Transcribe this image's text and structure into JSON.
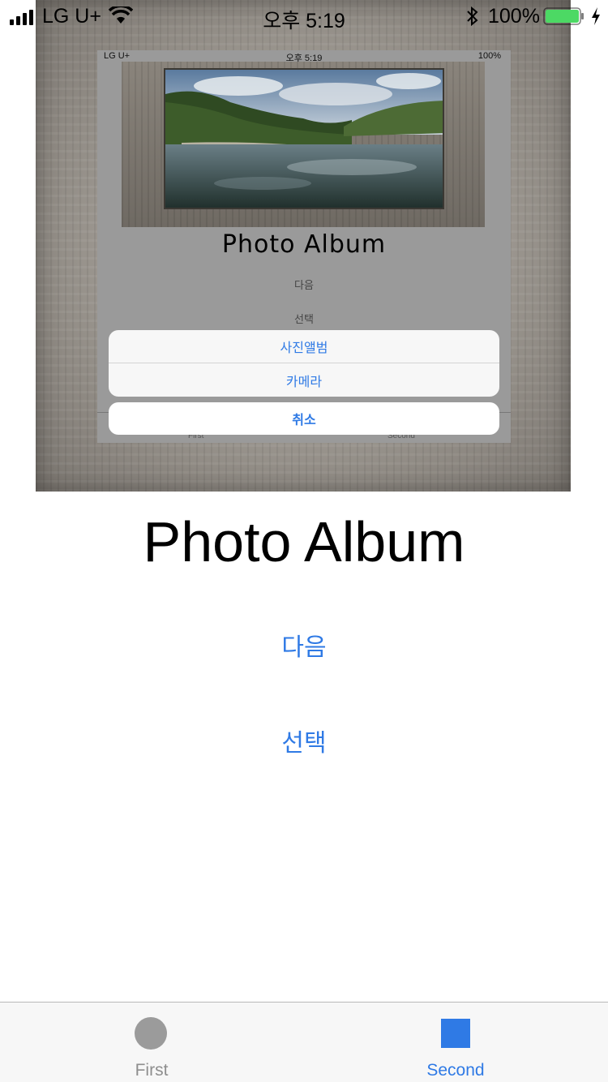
{
  "status_bar": {
    "carrier": "LG U+",
    "time": "오후 5:19",
    "battery_percent": "100%",
    "battery_level": 1.0,
    "icons": [
      "signal-icon",
      "wifi-icon",
      "bluetooth-icon",
      "battery-icon",
      "charging-icon"
    ]
  },
  "preview_image": {
    "status_bar": {
      "carrier": "LG U+",
      "time": "오후 5:19",
      "battery_percent": "100%"
    },
    "title": "Photo Album",
    "next_label": "다음",
    "select_label": "선택",
    "action_sheet": {
      "options": [
        "사진앨범",
        "카메라"
      ],
      "cancel": "취소"
    },
    "tabs": [
      "First",
      "Second"
    ]
  },
  "main": {
    "title": "Photo Album",
    "next_button": "다음",
    "select_button": "선택"
  },
  "tab_bar": {
    "tabs": [
      {
        "label": "First",
        "icon": "circle-icon",
        "selected": false
      },
      {
        "label": "Second",
        "icon": "square-icon",
        "selected": true
      }
    ]
  },
  "colors": {
    "accent": "#2f7ae5",
    "inactive_tab": "#8e8e8e",
    "tab_bar_bg": "#f7f7f7"
  }
}
